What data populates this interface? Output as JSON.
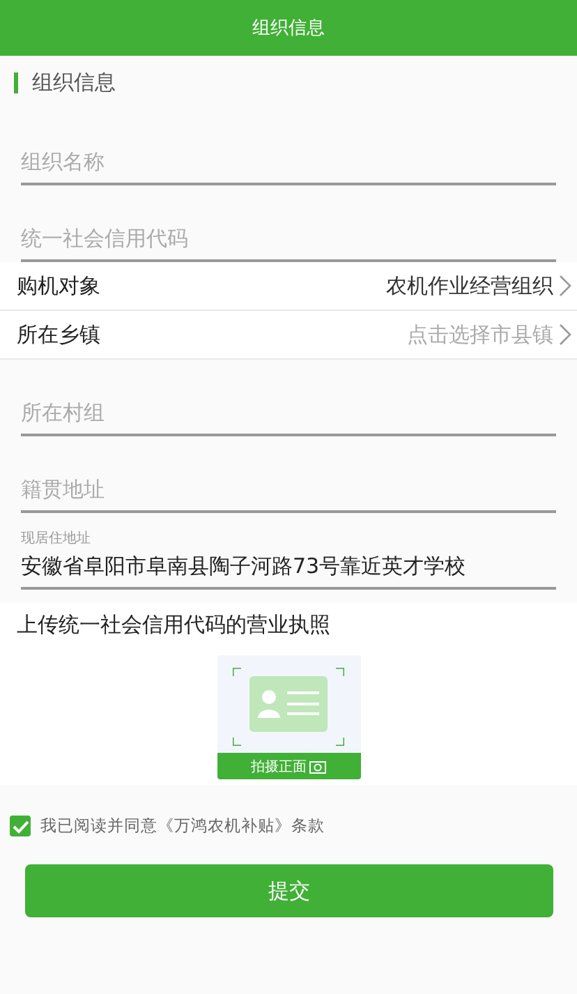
{
  "header": {
    "title": "组织信息"
  },
  "section_title": "组织信息",
  "fields_top": [
    {
      "placeholder": "组织名称"
    },
    {
      "placeholder": "统一社会信用代码"
    }
  ],
  "select_rows": [
    {
      "label": "购机对象",
      "value": "农机作业经营组织"
    },
    {
      "label": "所在乡镇",
      "placeholder": "点击选择市县镇"
    }
  ],
  "fields_bottom": [
    {
      "placeholder": "所在村组"
    },
    {
      "placeholder": "籍贯地址"
    },
    {
      "label": "现居住地址",
      "value": "安徽省阜阳市阜南县陶子河路73号靠近英才学校"
    }
  ],
  "upload": {
    "title": "上传统一社会信用代码的营业执照",
    "button": "拍摄正面"
  },
  "agreement": {
    "text": "我已阅读并同意《万鸿农机补贴》条款",
    "checked": true
  },
  "submit": "提交"
}
